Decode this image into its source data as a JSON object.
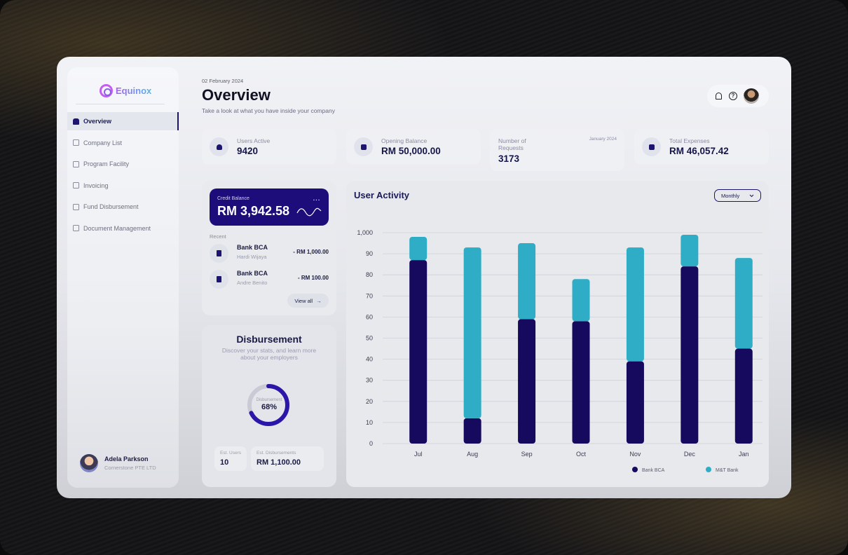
{
  "app": {
    "name": "Equinox"
  },
  "sidebar": {
    "items": [
      {
        "label": "Overview",
        "icon": "home-icon"
      },
      {
        "label": "Company List",
        "icon": "building-icon"
      },
      {
        "label": "Program Facility",
        "icon": "program-icon"
      },
      {
        "label": "Invoicing",
        "icon": "invoice-icon"
      },
      {
        "label": "Fund Disbursement",
        "icon": "fund-icon"
      },
      {
        "label": "Document Management",
        "icon": "document-icon"
      }
    ],
    "active": "Overview",
    "profile": {
      "name": "Adela Parkson",
      "company": "Cornerstone PTE LTD"
    }
  },
  "header": {
    "date": "02 February 2024",
    "title": "Overview",
    "subtitle": "Take a look at what you have inside your company",
    "icons": [
      "bell-icon",
      "help-icon",
      "avatar"
    ]
  },
  "stats": {
    "users": {
      "label": "Users Active",
      "value": "9420"
    },
    "opening": {
      "label": "Opening Balance",
      "value": "RM 50,000.00"
    },
    "requests": {
      "label": "Number of Requests",
      "date": "January 2024",
      "value": "3173"
    },
    "expenses": {
      "label": "Total Expenses",
      "value": "RM 46,057.42"
    }
  },
  "credit": {
    "label": "Credit Balance",
    "amount": "RM 3,942.58",
    "more": "...",
    "recent_label": "Recent",
    "transactions": [
      {
        "bank": "Bank BCA",
        "name": "Hardi Wijaya",
        "amount": "- RM 1,000.00"
      },
      {
        "bank": "Bank BCA",
        "name": "Andre Benito",
        "amount": "- RM 100.00"
      }
    ],
    "view_all": "View all",
    "view_all_arrow": "→"
  },
  "disbursement": {
    "title": "Disbursement",
    "description": "Discover your stats, and learn more about your employers",
    "donut_label": "Disbursement",
    "percent": "68%",
    "percent_value": 0.68,
    "est_users_label": "Est. Users",
    "est_users": "10",
    "est_disb_label": "Est. Disbursements",
    "est_disb": "RM 1,100.00"
  },
  "chart": {
    "title": "User Activity",
    "period": "Monthly",
    "colors": {
      "bca": "#160a5e",
      "mt": "#2fadc6"
    }
  },
  "chart_data": {
    "type": "bar",
    "stacked": true,
    "categories": [
      "Jul",
      "Aug",
      "Sep",
      "Oct",
      "Nov",
      "Dec",
      "Jan"
    ],
    "series": [
      {
        "name": "Bank BCA",
        "values": [
          87,
          12,
          59,
          58,
          39,
          84,
          45
        ]
      },
      {
        "name": "M&T Bank",
        "values": [
          11,
          81,
          36,
          20,
          54,
          15,
          43
        ]
      }
    ],
    "y_ticks": [
      "0",
      "10",
      "20",
      "30",
      "40",
      "50",
      "60",
      "70",
      "80",
      "90",
      "1,000"
    ],
    "ylim": [
      0,
      100
    ],
    "grid": true,
    "legend": "bottom-right"
  }
}
